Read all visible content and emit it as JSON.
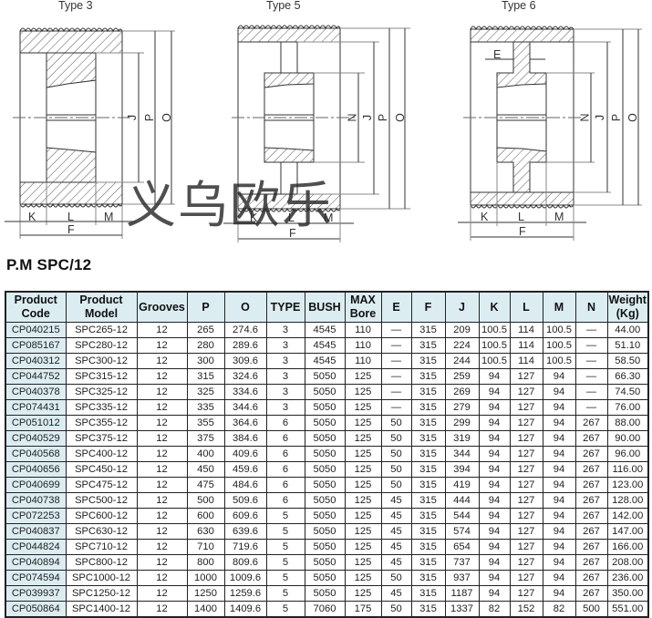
{
  "diagrams": [
    {
      "id": "type3",
      "title": "Type 3",
      "dims": [
        "J",
        "P",
        "O"
      ],
      "bottom_dims": [
        "K",
        "L",
        "M",
        "F"
      ]
    },
    {
      "id": "type5",
      "title": "Type 5",
      "dims": [
        "N",
        "J",
        "P",
        "O"
      ],
      "bottom_dims": [
        "K",
        "L",
        "M",
        "F"
      ]
    },
    {
      "id": "type6",
      "title": "Type 6",
      "dims": [
        "N",
        "J",
        "P",
        "O"
      ],
      "bottom_dims": [
        "K",
        "L",
        "M",
        "F"
      ],
      "extra_dim": "E"
    }
  ],
  "watermark": "义乌欧乐",
  "section_title": "P.M SPC/12",
  "colors": {
    "header_bg": "#dcedf2",
    "code_bg": "#dcedf2",
    "border": "#222222"
  },
  "table": {
    "headers": [
      "Product\nCode",
      "Product\nModel",
      "Grooves",
      "P",
      "O",
      "TYPE",
      "BUSH",
      "MAX\nBore",
      "E",
      "F",
      "J",
      "K",
      "L",
      "M",
      "N",
      "Weight\n(Kg)"
    ],
    "header_lines": [
      [
        "Product",
        "Code"
      ],
      [
        "Product",
        "Model"
      ],
      [
        "Grooves"
      ],
      [
        "P"
      ],
      [
        "O"
      ],
      [
        "TYPE"
      ],
      [
        "BUSH"
      ],
      [
        "MAX",
        "Bore"
      ],
      [
        "E"
      ],
      [
        "F"
      ],
      [
        "J"
      ],
      [
        "K"
      ],
      [
        "L"
      ],
      [
        "M"
      ],
      [
        "N"
      ],
      [
        "Weight",
        "(Kg)"
      ]
    ],
    "rows": [
      [
        "CP040215",
        "SPC265-12",
        "12",
        "265",
        "274.6",
        "3",
        "4545",
        "110",
        "—",
        "315",
        "209",
        "100.5",
        "114",
        "100.5",
        "—",
        "44.00"
      ],
      [
        "CP085167",
        "SPC280-12",
        "12",
        "280",
        "289.6",
        "3",
        "4545",
        "110",
        "—",
        "315",
        "224",
        "100.5",
        "114",
        "100.5",
        "—",
        "51.10"
      ],
      [
        "CP040312",
        "SPC300-12",
        "12",
        "300",
        "309.6",
        "3",
        "4545",
        "110",
        "—",
        "315",
        "244",
        "100.5",
        "114",
        "100.5",
        "—",
        "58.50"
      ],
      [
        "CP044752",
        "SPC315-12",
        "12",
        "315",
        "324.6",
        "3",
        "5050",
        "125",
        "—",
        "315",
        "259",
        "94",
        "127",
        "94",
        "—",
        "66.30"
      ],
      [
        "CP040378",
        "SPC325-12",
        "12",
        "325",
        "334.6",
        "3",
        "5050",
        "125",
        "—",
        "315",
        "269",
        "94",
        "127",
        "94",
        "—",
        "74.50"
      ],
      [
        "CP074431",
        "SPC335-12",
        "12",
        "335",
        "344.6",
        "3",
        "5050",
        "125",
        "—",
        "315",
        "279",
        "94",
        "127",
        "94",
        "—",
        "76.00"
      ],
      [
        "CP051012",
        "SPC355-12",
        "12",
        "355",
        "364.6",
        "6",
        "5050",
        "125",
        "50",
        "315",
        "299",
        "94",
        "127",
        "94",
        "267",
        "88.00"
      ],
      [
        "CP040529",
        "SPC375-12",
        "12",
        "375",
        "384.6",
        "6",
        "5050",
        "125",
        "50",
        "315",
        "319",
        "94",
        "127",
        "94",
        "267",
        "90.00"
      ],
      [
        "CP040568",
        "SPC400-12",
        "12",
        "400",
        "409.6",
        "6",
        "5050",
        "125",
        "50",
        "315",
        "344",
        "94",
        "127",
        "94",
        "267",
        "96.00"
      ],
      [
        "CP040656",
        "SPC450-12",
        "12",
        "450",
        "459.6",
        "6",
        "5050",
        "125",
        "50",
        "315",
        "394",
        "94",
        "127",
        "94",
        "267",
        "116.00"
      ],
      [
        "CP040699",
        "SPC475-12",
        "12",
        "475",
        "484.6",
        "6",
        "5050",
        "125",
        "50",
        "315",
        "419",
        "94",
        "127",
        "94",
        "267",
        "123.00"
      ],
      [
        "CP040738",
        "SPC500-12",
        "12",
        "500",
        "509.6",
        "6",
        "5050",
        "125",
        "45",
        "315",
        "444",
        "94",
        "127",
        "94",
        "267",
        "128.00"
      ],
      [
        "CP072253",
        "SPC600-12",
        "12",
        "600",
        "609.6",
        "5",
        "5050",
        "125",
        "45",
        "315",
        "544",
        "94",
        "127",
        "94",
        "267",
        "142.00"
      ],
      [
        "CP040837",
        "SPC630-12",
        "12",
        "630",
        "639.6",
        "5",
        "5050",
        "125",
        "45",
        "315",
        "574",
        "94",
        "127",
        "94",
        "267",
        "147.00"
      ],
      [
        "CP044824",
        "SPC710-12",
        "12",
        "710",
        "719.6",
        "5",
        "5050",
        "125",
        "45",
        "315",
        "654",
        "94",
        "127",
        "94",
        "267",
        "166.00"
      ],
      [
        "CP040894",
        "SPC800-12",
        "12",
        "800",
        "809.6",
        "5",
        "5050",
        "125",
        "45",
        "315",
        "737",
        "94",
        "127",
        "94",
        "267",
        "208.00"
      ],
      [
        "CP074594",
        "SPC1000-12",
        "12",
        "1000",
        "1009.6",
        "5",
        "5050",
        "125",
        "50",
        "315",
        "937",
        "94",
        "127",
        "94",
        "267",
        "236.00"
      ],
      [
        "CP039937",
        "SPC1250-12",
        "12",
        "1250",
        "1259.6",
        "5",
        "5050",
        "125",
        "45",
        "315",
        "1187",
        "94",
        "127",
        "94",
        "267",
        "350.00"
      ],
      [
        "CP050864",
        "SPC1400-12",
        "12",
        "1400",
        "1409.6",
        "5",
        "7060",
        "175",
        "50",
        "315",
        "1337",
        "82",
        "152",
        "82",
        "500",
        "551.00"
      ]
    ]
  }
}
